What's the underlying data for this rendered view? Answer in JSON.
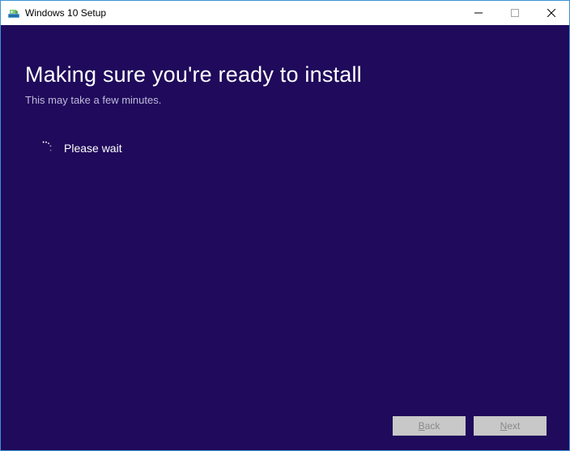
{
  "window": {
    "title": "Windows 10 Setup"
  },
  "content": {
    "heading": "Making sure you're ready to install",
    "subheading": "This may take a few minutes.",
    "wait_text": "Please wait"
  },
  "buttons": {
    "back_prefix": "B",
    "back_rest": "ack",
    "next_prefix": "N",
    "next_rest": "ext"
  },
  "colors": {
    "accent": "#1f0a5b",
    "border": "#3a93d6"
  }
}
